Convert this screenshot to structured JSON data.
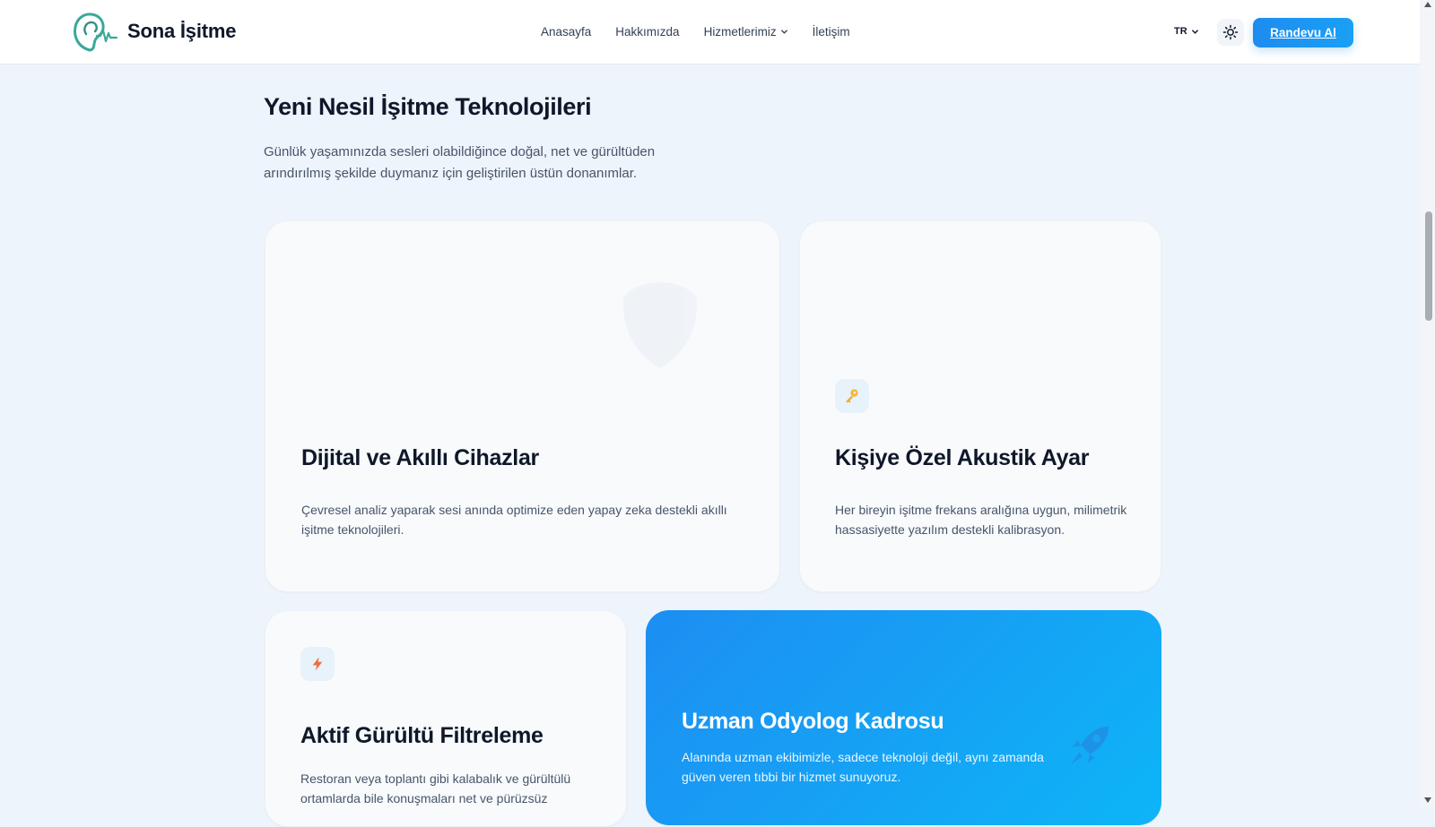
{
  "header": {
    "brand": "Sona İşitme",
    "nav": [
      "Anasayfa",
      "Hakkımızda",
      "Hizmetlerimiz",
      "İletişim"
    ],
    "lang": "TR",
    "cta": "Randevu Al"
  },
  "section": {
    "title": "Yeni Nesil İşitme Teknolojileri",
    "desc": "Günlük yaşamınızda sesleri olabildiğince doğal, net ve gürültüden arındırılmış şekilde duymanız için geliştirilen üstün donanımlar."
  },
  "cards": [
    {
      "title": "Dijital ve Akıllı Cihazlar",
      "desc": "Çevresel analiz yaparak sesi anında optimize eden yapay zeka destekli akıllı işitme teknolojileri.",
      "icon": "shield-icon"
    },
    {
      "title": "Kişiye Özel Akustik Ayar",
      "desc": "Her bireyin işitme frekans aralığına uygun, milimetrik hassasiyette yazılım destekli kalibrasyon.",
      "icon": "key-icon"
    },
    {
      "title": "Aktif Gürültü Filtreleme",
      "desc": "Restoran veya toplantı gibi kalabalık ve gürültülü ortamlarda bile konuşmaları net ve pürüzsüz",
      "icon": "lightning-icon"
    },
    {
      "title": "Uzman Odyolog Kadrosu",
      "desc": "Alanında uzman ekibimizle, sadece teknoloji değil, aynı zamanda güven veren tıbbi bir hizmet sunuyoruz.",
      "icon": "rocket-icon"
    }
  ],
  "colors": {
    "accent": "#1d8cf0",
    "page_bg": "#eef4fb",
    "card_bg": "#f8fafc",
    "logo_teal": "#3aa89b"
  }
}
